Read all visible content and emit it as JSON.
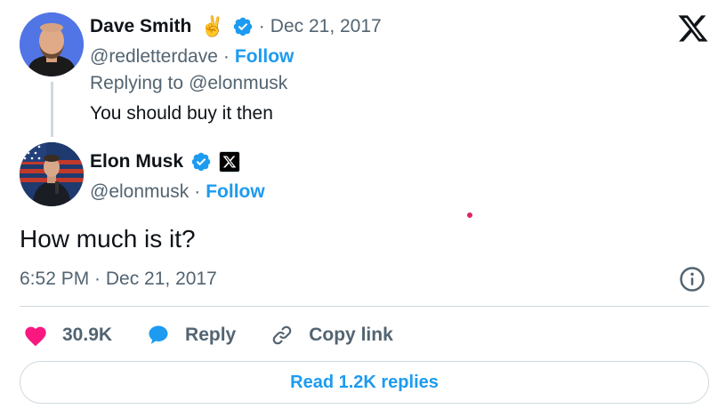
{
  "parent_tweet": {
    "name": "Dave Smith",
    "badge_emoji": "✌️",
    "date": "Dec 21, 2017",
    "handle": "@redletterdave",
    "follow_label": "Follow",
    "replying_prefix": "Replying to",
    "replying_to": "@elonmusk",
    "text": "You should buy it then"
  },
  "main_tweet": {
    "name": "Elon Musk",
    "handle": "@elonmusk",
    "follow_label": "Follow",
    "text": "How much is it?",
    "timestamp": "6:52 PM · Dec 21, 2017"
  },
  "actions": {
    "likes": "30.9K",
    "reply_label": "Reply",
    "copy_link_label": "Copy link"
  },
  "read_replies_label": "Read 1.2K replies",
  "colors": {
    "accent": "#1d9bf0",
    "like": "#f91880",
    "text": "#0f1419",
    "muted": "#536471",
    "border": "#cfd9de"
  },
  "icons": [
    "x-logo-icon",
    "verified-icon",
    "affiliate-x-icon",
    "info-icon",
    "heart-icon",
    "reply-bubble-icon",
    "link-icon"
  ]
}
